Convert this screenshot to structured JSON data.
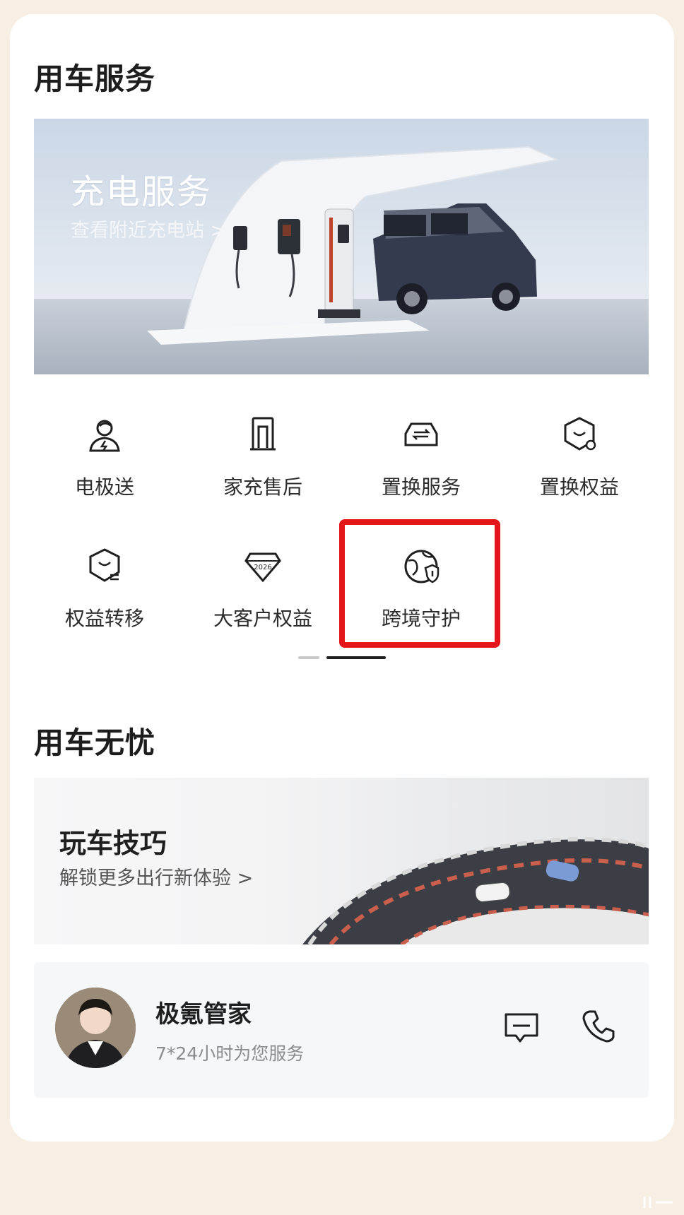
{
  "service": {
    "title": "用车服务",
    "banner": {
      "title": "充电服务",
      "subtitle": "查看附近充电站 >"
    },
    "items": [
      {
        "label": "电极送",
        "icon": "service-person-icon"
      },
      {
        "label": "家充售后",
        "icon": "home-charger-icon"
      },
      {
        "label": "置换服务",
        "icon": "car-exchange-icon"
      },
      {
        "label": "置换权益",
        "icon": "exchange-benefit-icon"
      },
      {
        "label": "权益转移",
        "icon": "benefit-transfer-icon"
      },
      {
        "label": "大客户权益",
        "icon": "diamond-2026-icon"
      },
      {
        "label": "跨境守护",
        "icon": "globe-shield-icon"
      }
    ],
    "diamond_text": "2026",
    "highlight_color": "#e3161a"
  },
  "worry_free": {
    "title": "用车无忧",
    "banner": {
      "title": "玩车技巧",
      "subtitle": "解锁更多出行新体验 >"
    },
    "steward": {
      "name": "极氪管家",
      "subtitle": "7*24小时为您服务"
    }
  }
}
